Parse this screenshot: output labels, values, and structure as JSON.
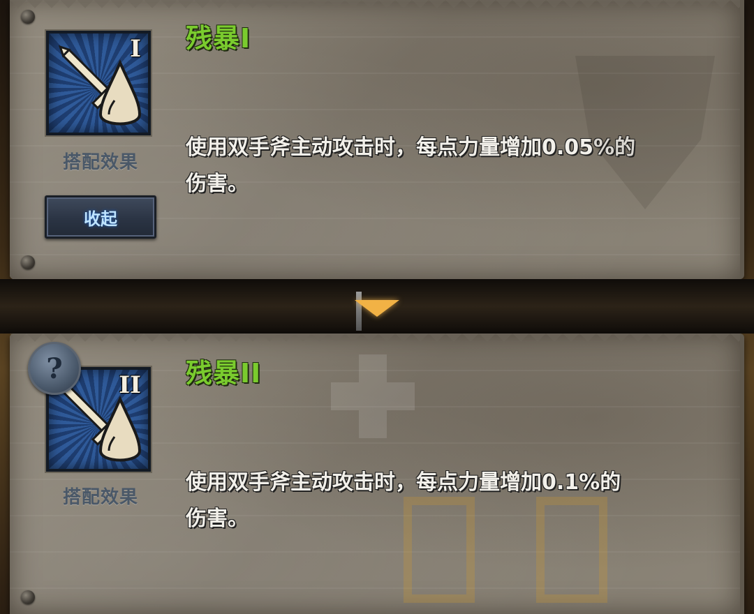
{
  "skills": [
    {
      "title": "残暴I",
      "roman": "I",
      "icon_label": "搭配效果",
      "icon_name": "sword-drop-icon",
      "desc_line1": "使用双手斧主动攻击时，每点力量增加0.05%的",
      "desc_line2": "伤害。"
    },
    {
      "title": "残暴II",
      "roman": "II",
      "icon_label": "搭配效果",
      "icon_name": "sword-drop-icon",
      "desc_line1": "使用双手斧主动攻击时，每点力量增加0.1%的",
      "desc_line2": "伤害。"
    }
  ],
  "controls": {
    "collapse_label": "收起",
    "help_symbol": "?",
    "expand_icon": "triangle-down-icon"
  },
  "colors": {
    "title_green": "#7acb2e",
    "accent_orange": "#f2b245",
    "icon_blue": "#2f5a99"
  }
}
